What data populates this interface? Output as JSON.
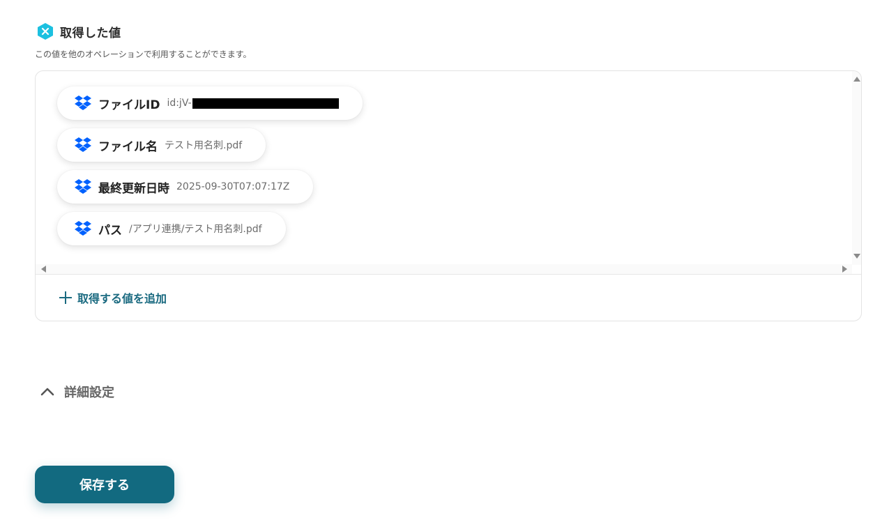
{
  "section": {
    "title": "取得した値",
    "description": "この値を他のオペレーションで利用することができます。"
  },
  "values": [
    {
      "label": "ファイルID",
      "value": "id:jV-",
      "redacted": true
    },
    {
      "label": "ファイル名",
      "value": "テスト用名刺.pdf"
    },
    {
      "label": "最終更新日時",
      "value": "2025-09-30T07:07:17Z"
    },
    {
      "label": "パス",
      "value": "/アプリ連携/テスト用名刺.pdf"
    }
  ],
  "add_value_label": "取得する値を追加",
  "details": {
    "label": "詳細設定"
  },
  "save_button_label": "保存する",
  "colors": {
    "accent": "#126a80",
    "link": "#1a6a80",
    "dropbox_blue": "#0061fe",
    "section_icon": "#1cc0e0"
  },
  "icons": {
    "section": "yoom-x-icon",
    "value": "dropbox-icon",
    "add": "plus-icon",
    "details": "chevron-up-icon"
  }
}
